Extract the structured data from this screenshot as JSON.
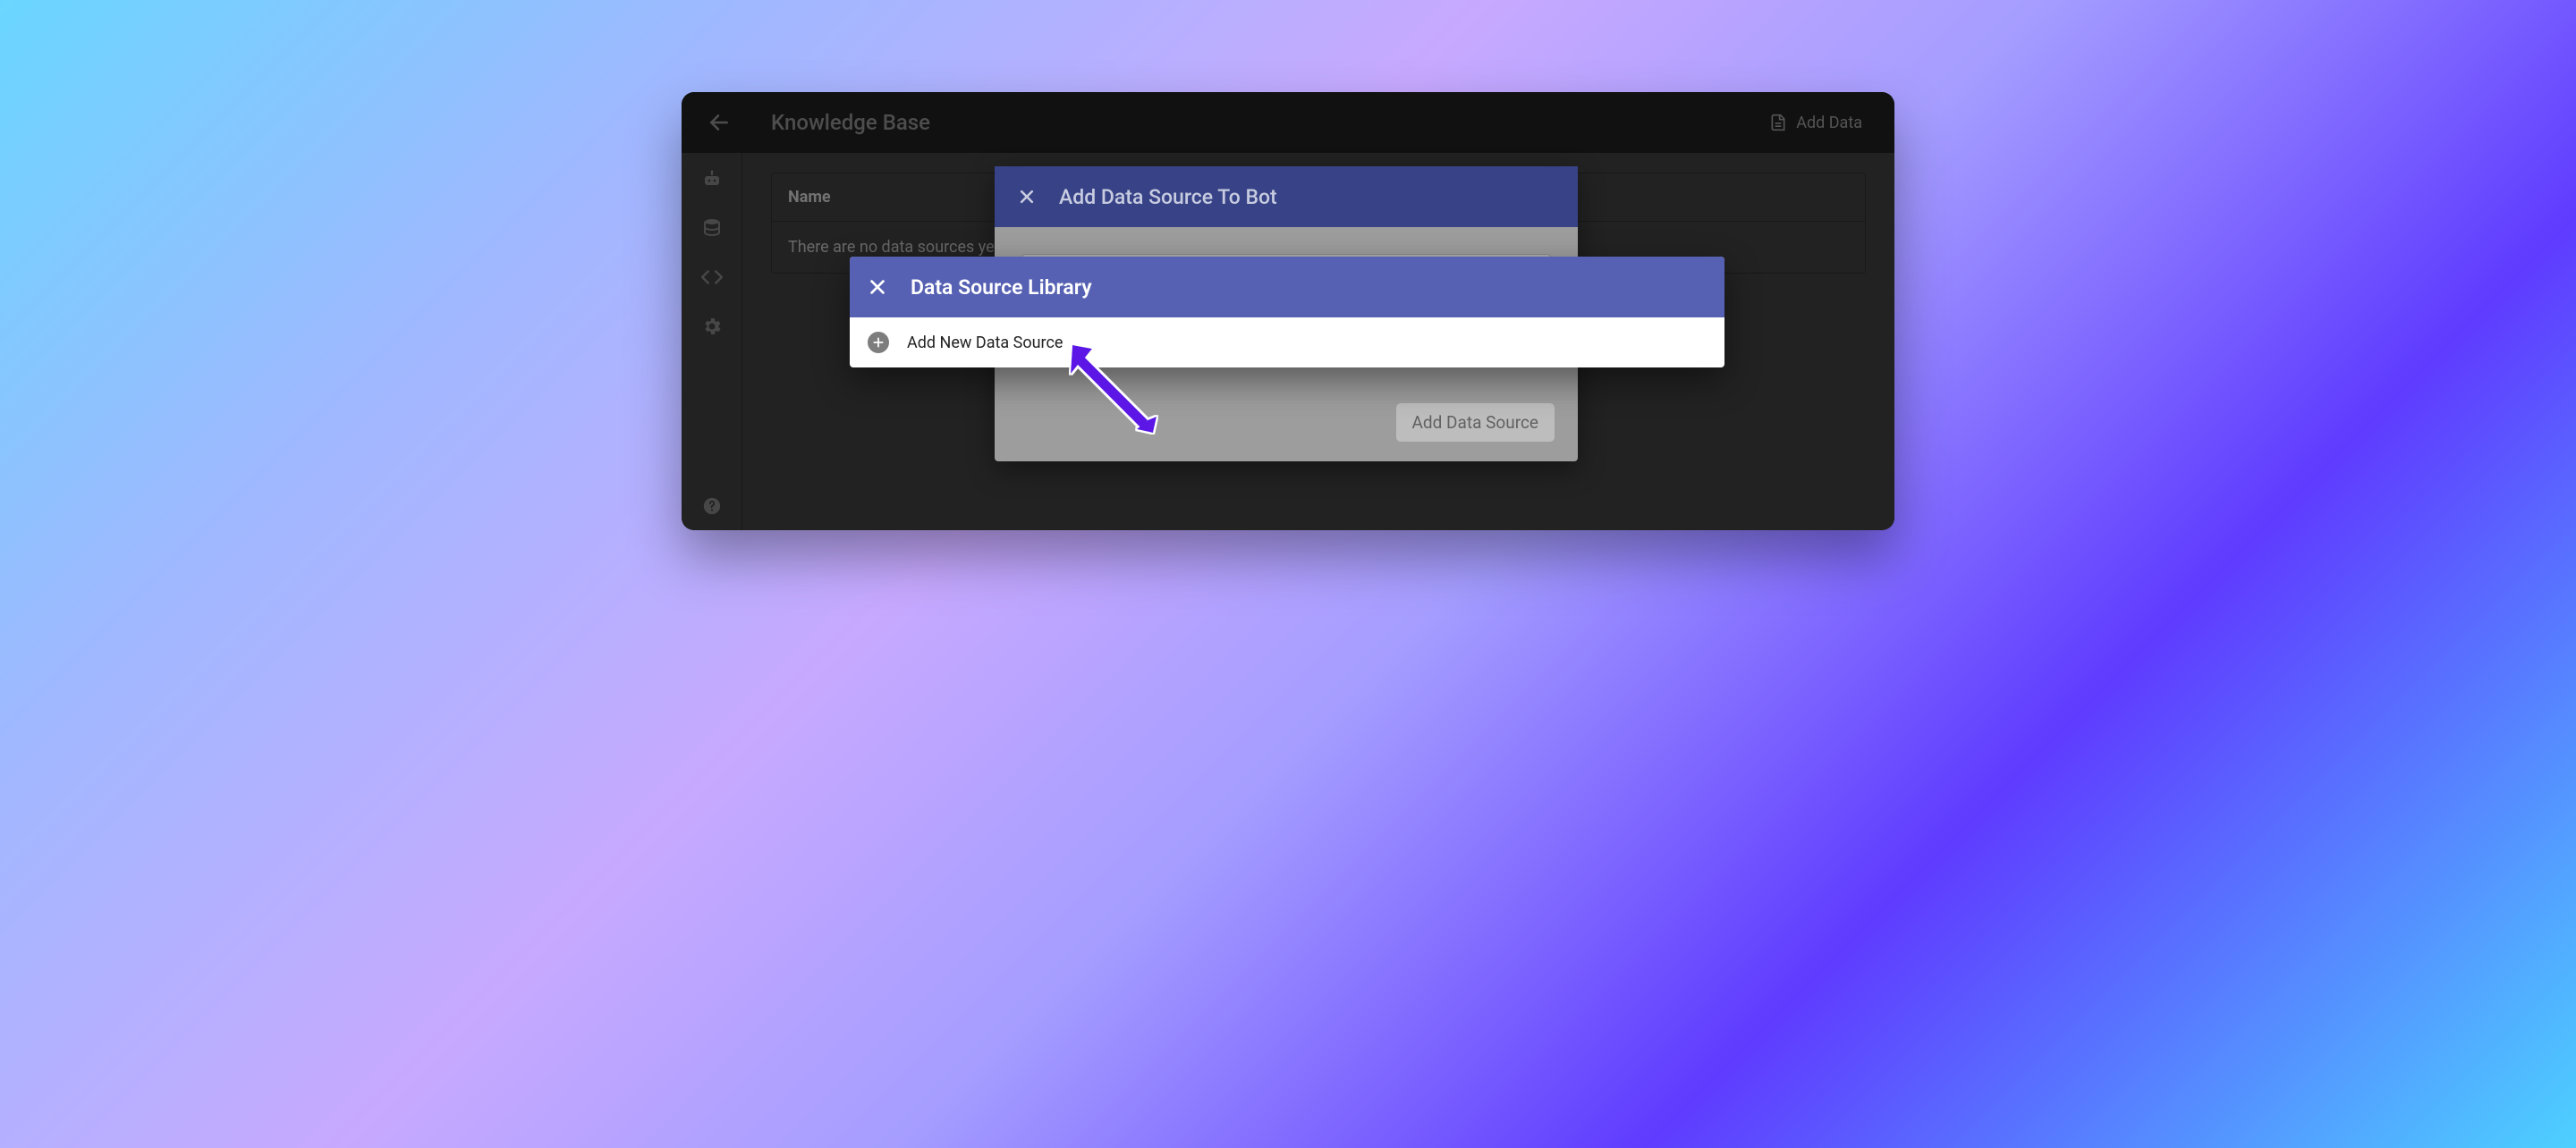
{
  "header": {
    "title": "Knowledge Base",
    "add_data_label": "Add Data"
  },
  "table": {
    "col_name": "Name",
    "empty_text": "There are no data sources yet. St"
  },
  "modal_add_to_bot": {
    "title": "Add Data Source To Bot",
    "submit_label": "Add Data Source"
  },
  "modal_library": {
    "title": "Data Source Library",
    "add_new_label": "Add New Data Source"
  }
}
